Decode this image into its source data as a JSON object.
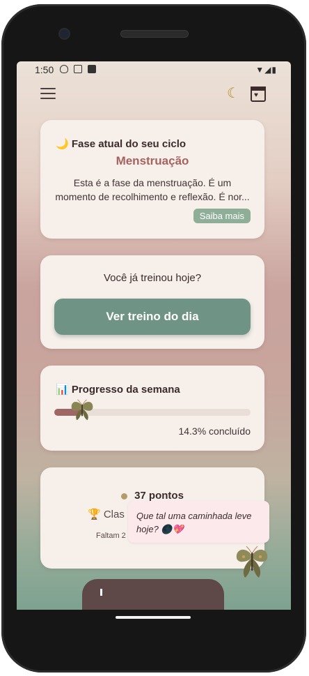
{
  "status_bar": {
    "time": "1:50",
    "icons": [
      "shield-icon",
      "a-icon",
      "sd-card-icon"
    ],
    "right_icons": [
      "wifi-icon",
      "signal-icon",
      "battery-icon"
    ]
  },
  "header": {
    "menu_icon": "hamburger-menu-icon",
    "moon_icon": "crescent-moon-icon",
    "calendar_icon": "calendar-heart-icon"
  },
  "phase_card": {
    "title": "🌙 Fase atual do seu ciclo",
    "phase": "Menstruação",
    "description": "Esta é a fase da menstruação. É um momento de recolhimento e reflexão. É nor...",
    "button": "Saiba mais"
  },
  "training_card": {
    "question": "Você já treinou hoje?",
    "button": "Ver treino do dia"
  },
  "progress_card": {
    "title": "📊 Progresso da semana",
    "progress": 0.143,
    "percent_label": "14.3% concluído"
  },
  "points_card": {
    "points": "37 pontos",
    "classification": "🏆 Clas",
    "remaining": "Faltam 2"
  },
  "tooltip": {
    "message": "Que tal uma caminhada leve hoje? 🌑💖"
  },
  "colors": {
    "accent_green": "#6f9485",
    "phase_text": "#a5635f",
    "progress_fill": "#9e6664"
  }
}
